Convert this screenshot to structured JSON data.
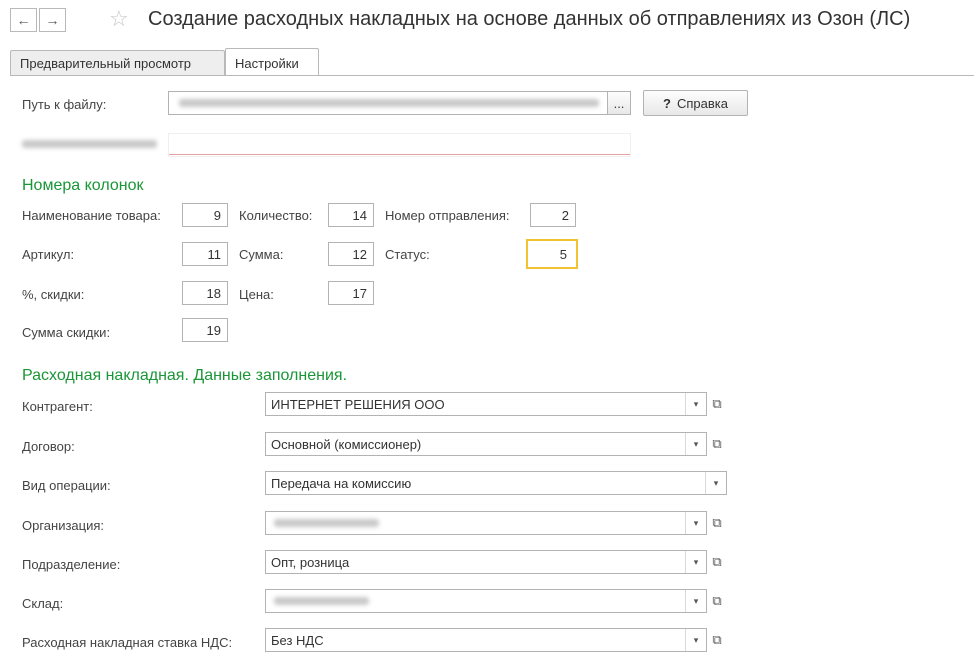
{
  "header": {
    "back_icon": "←",
    "forward_icon": "→",
    "star_icon": "☆",
    "title": "Создание расходных накладных на основе данных об отправлениях из Озон (ЛС)"
  },
  "tabs": [
    "Предварительный просмотр",
    "Настройки"
  ],
  "file": {
    "label": "Путь к файлу:",
    "browse_label": "...",
    "help_label": "Справка",
    "help_icon": "?"
  },
  "columns": {
    "heading": "Номера колонок",
    "name_label": "Наименование товара:",
    "name_value": "9",
    "qty_label": "Количество:",
    "qty_value": "14",
    "shipment_label": "Номер отправления:",
    "shipment_value": "2",
    "article_label": "Артикул:",
    "article_value": "11",
    "sum_label": "Сумма:",
    "sum_value": "12",
    "status_label": "Статус:",
    "status_value": "5",
    "discount_pct_label": "%, скидки:",
    "discount_pct_value": "18",
    "price_label": "Цена:",
    "price_value": "17",
    "discount_sum_label": "Сумма скидки:",
    "discount_sum_value": "19"
  },
  "invoice": {
    "heading": "Расходная накладная. Данные заполнения.",
    "counterparty_label": "Контрагент:",
    "counterparty_value": "ИНТЕРНЕТ РЕШЕНИЯ ООО",
    "contract_label": "Договор:",
    "contract_value": "Основной (комиссионер)",
    "operation_label": "Вид операции:",
    "operation_value": "Передача на комиссию",
    "organization_label": "Организация:",
    "department_label": "Подразделение:",
    "department_value": "Опт, розница",
    "warehouse_label": "Склад:",
    "vat_label": "Расходная накладная ставка НДС:",
    "vat_value": "Без НДС"
  },
  "icons": {
    "dropdown": "▾",
    "open": "⧉"
  }
}
